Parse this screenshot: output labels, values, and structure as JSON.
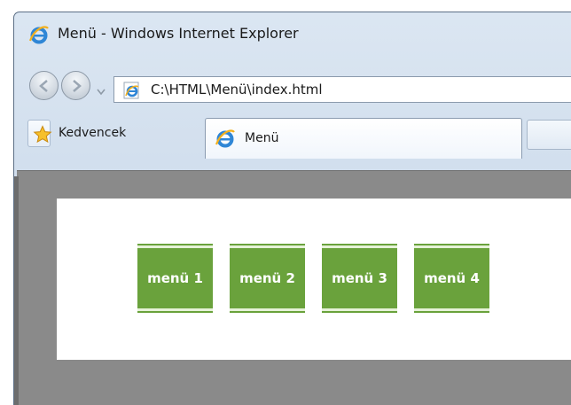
{
  "window": {
    "title": "Menü - Windows Internet Explorer",
    "icon": "ie-icon"
  },
  "navigation": {
    "back_icon": "back-arrow-icon",
    "forward_icon": "forward-arrow-icon",
    "dropdown_icon": "chevron-down-icon",
    "address": "C:\\HTML\\Menü\\index.html",
    "page_icon": "ie-page-icon"
  },
  "favorites": {
    "label": "Kedvencek",
    "icon": "star-icon"
  },
  "tabs": [
    {
      "label": "Menü",
      "icon": "ie-icon",
      "active": true
    }
  ],
  "page": {
    "menu": [
      {
        "label": "menü 1"
      },
      {
        "label": "menü 2"
      },
      {
        "label": "menü 3"
      },
      {
        "label": "menü 4"
      }
    ]
  },
  "colors": {
    "menu_green": "#6aa23c",
    "viewport_gray": "#8a8a8a"
  }
}
